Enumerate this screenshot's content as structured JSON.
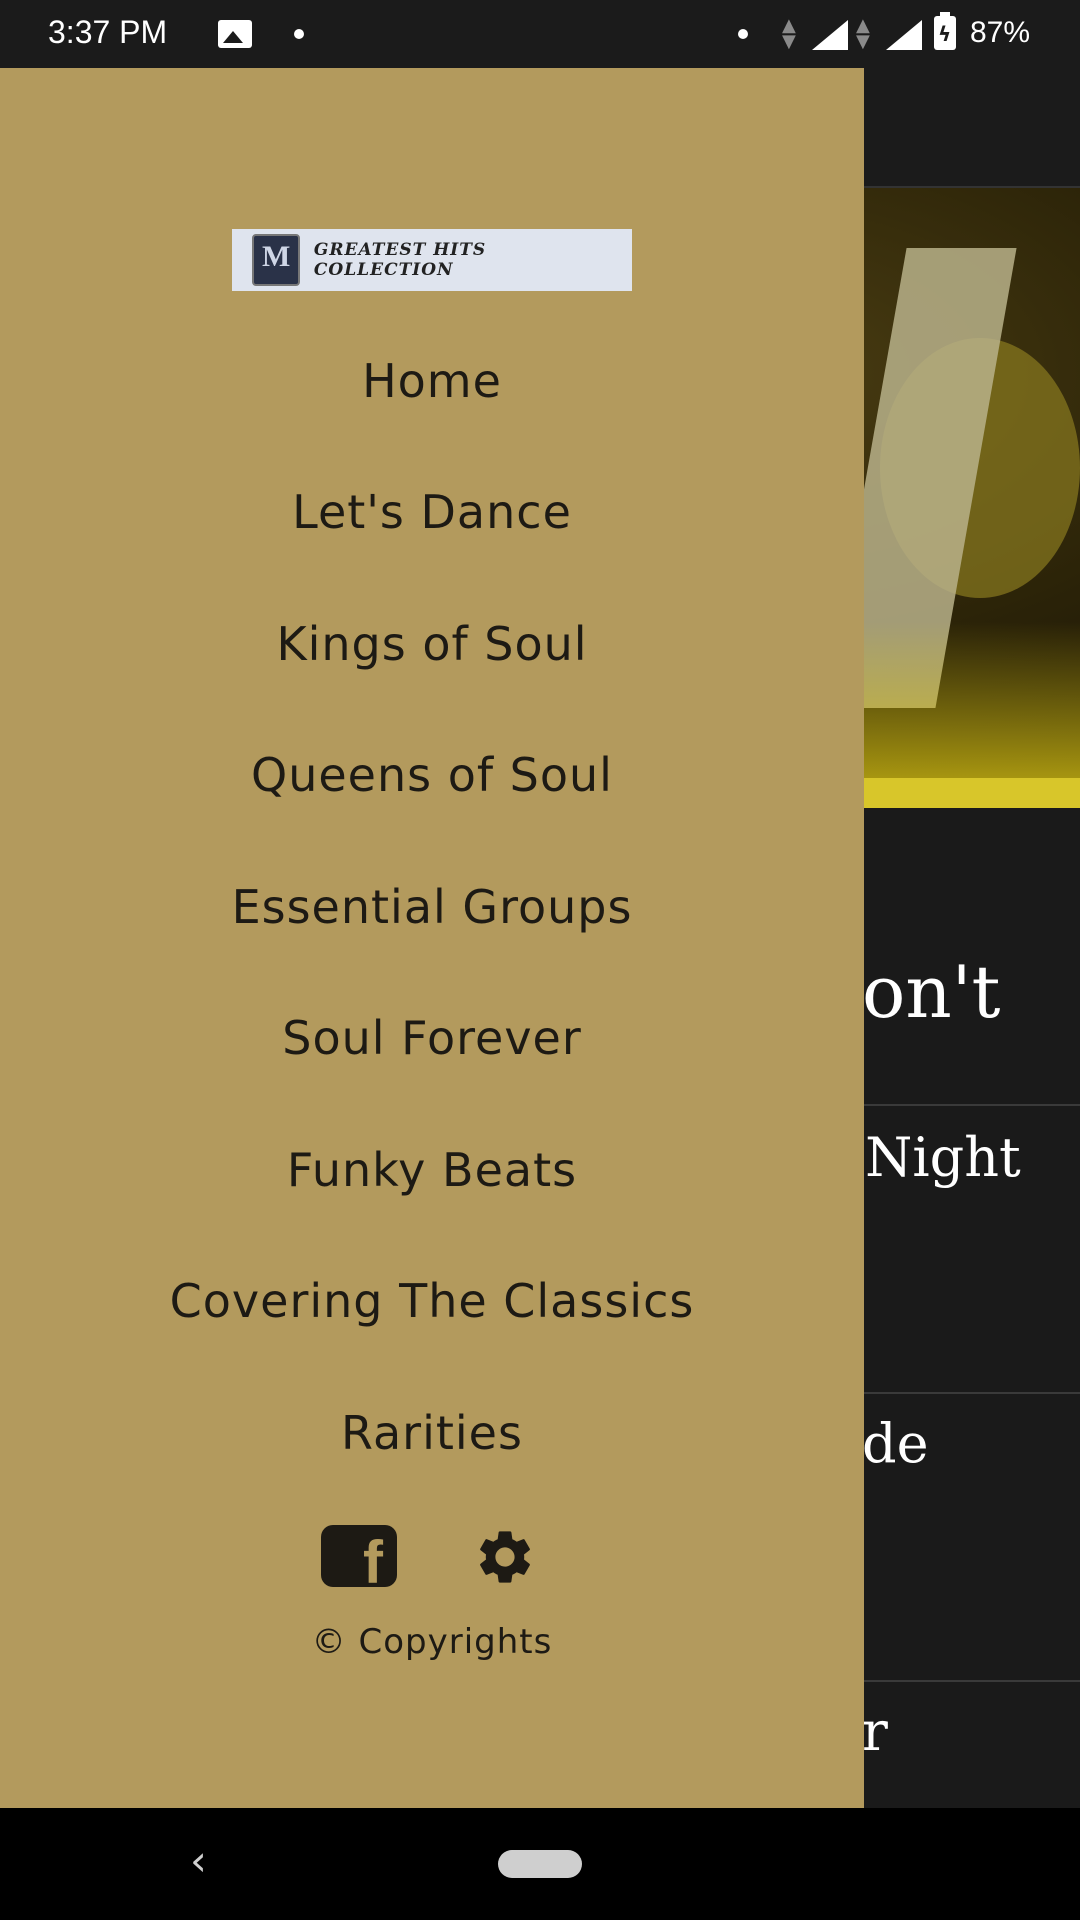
{
  "status_bar": {
    "time": "3:37 PM",
    "battery_percent": "87%",
    "icons": [
      "image-icon",
      "notification-dot-icon",
      "wifi-dot-icon",
      "data-arrows-icon",
      "signal-icon",
      "battery-charging-icon"
    ]
  },
  "drawer": {
    "logo_text": "GREATEST HITS COLLECTION",
    "menu_items": [
      {
        "label": "Home"
      },
      {
        "label": "Let's Dance"
      },
      {
        "label": "Kings of Soul"
      },
      {
        "label": "Queens of Soul"
      },
      {
        "label": "Essential Groups"
      },
      {
        "label": "Soul Forever"
      },
      {
        "label": "Funky Beats"
      },
      {
        "label": "Covering The Classics"
      },
      {
        "label": "Rarities"
      }
    ],
    "social_icons": [
      "facebook-icon",
      "settings-gear-icon"
    ],
    "copyright": "© Copyrights",
    "background_color": "#b39a5d"
  },
  "background_list": {
    "rows": [
      {
        "partial_title": "on't"
      },
      {
        "partial_title": " Night"
      },
      {
        "partial_title": "de"
      },
      {
        "partial_title": "r"
      }
    ]
  },
  "nav_bar": {
    "back_glyph": "‹"
  }
}
